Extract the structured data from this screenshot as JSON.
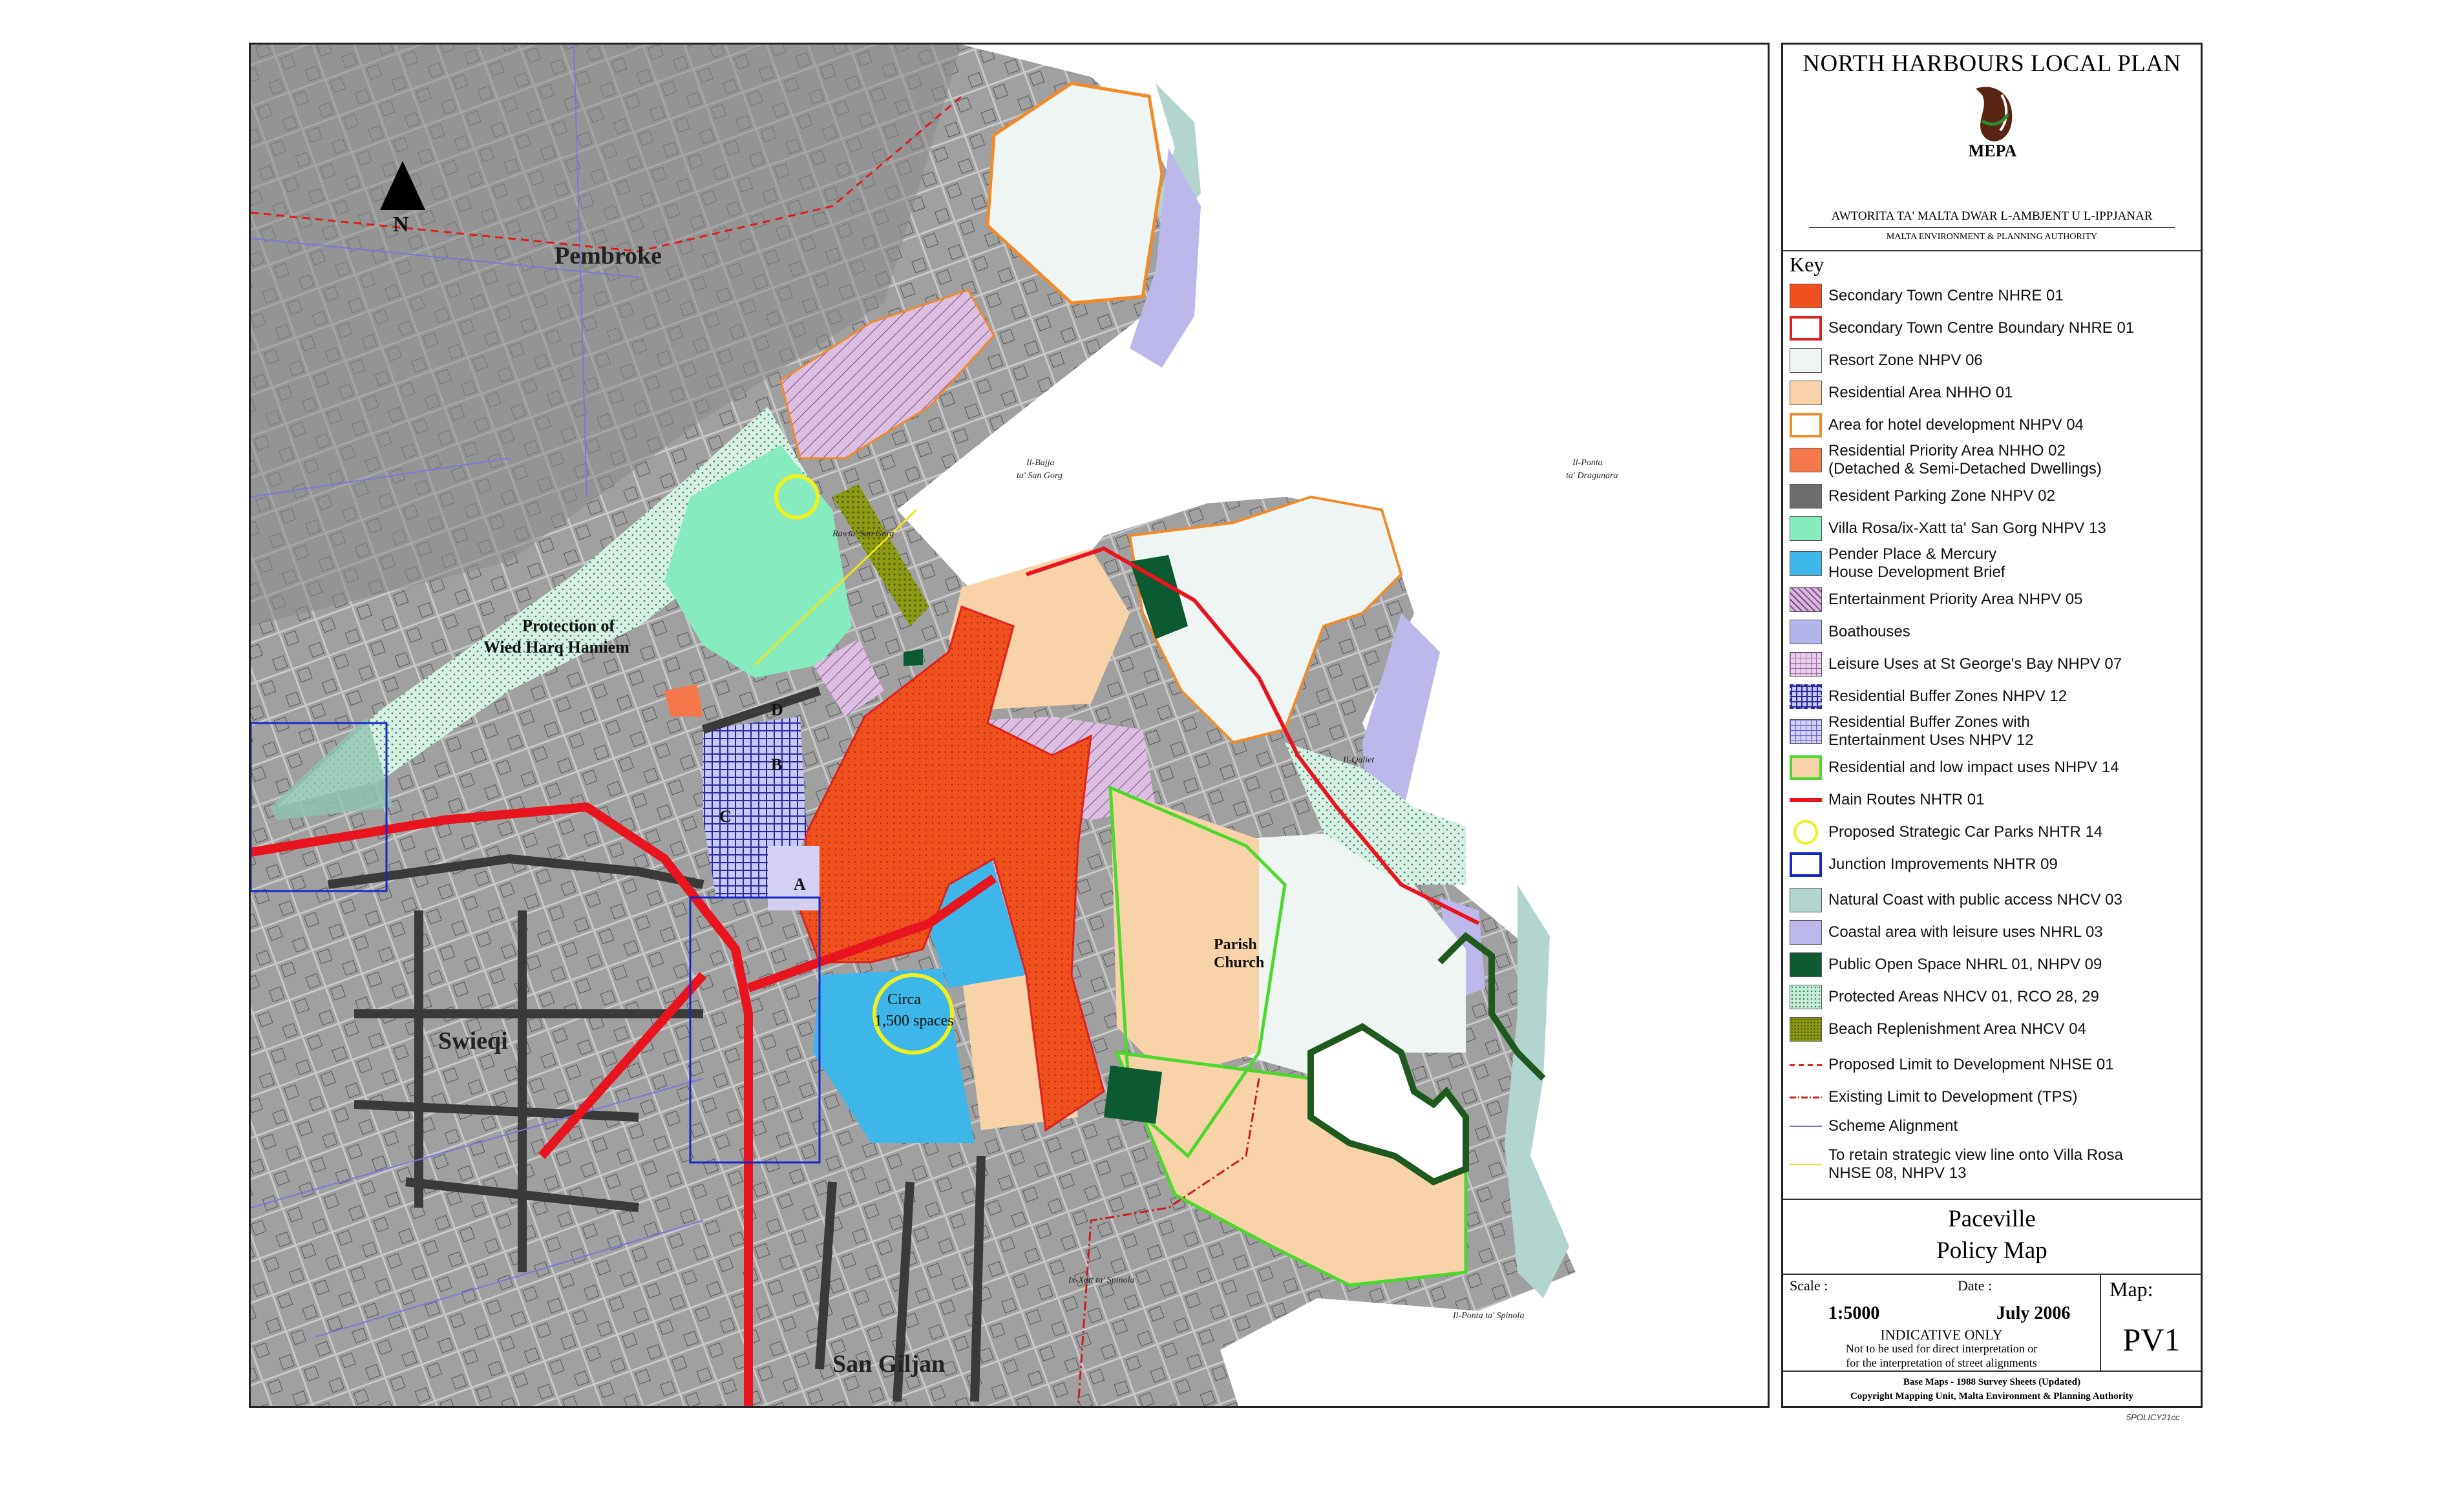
{
  "map": {
    "north_label": "N",
    "places": {
      "pembroke": "Pembroke",
      "swieqi": "Swieqi",
      "san_giljan": "San Giljan",
      "wied_line1": "Protection of",
      "wied_line2": "Wied Harq Hamiem",
      "parish_line1": "Parish",
      "parish_line2": "Church",
      "car_park_line1": "Circa",
      "car_park_line2": "1,500 spaces",
      "il_bajja": "Il-Bajja",
      "ta_san_gorg": "ta' San Gorg",
      "ras_san_gorg": "Ras ta' San Gorg",
      "il_ponta": "Il-Ponta",
      "ta_dragunara": "ta' Dragunara",
      "il_qaliet": "Il-Qaliet",
      "xatt_spinola": "Ix-Xatt ta' Spinola",
      "ponta_spinola": "Il-Ponta ta' Spinola"
    },
    "junction_letters": [
      "A",
      "B",
      "C",
      "D"
    ]
  },
  "panel": {
    "plan_title": "NORTH HARBOURS LOCAL PLAN",
    "logo_text": "MEPA",
    "authority_maltese": "AWTORITA  TA' MALTA DWAR L-AMBJENT U L-IPPJANAR",
    "authority_english": "MALTA ENVIRONMENT & PLANNING AUTHORITY",
    "key_heading": "Key",
    "legend": [
      {
        "label": "Secondary Town Centre NHRE 01",
        "style": "fill",
        "color": "#f0501e"
      },
      {
        "label": "Secondary Town Centre Boundary NHRE 01",
        "style": "outline",
        "color": "#e02020"
      },
      {
        "label": "Resort Zone NHPV 06",
        "style": "fill",
        "color": "#eef5f2"
      },
      {
        "label": "Residential Area NHHO 01",
        "style": "fill",
        "color": "#f8d3a8"
      },
      {
        "label": "Area for hotel development NHPV 04",
        "style": "outline",
        "color": "#f08a2a"
      },
      {
        "label": "Residential Priority Area NHHO 02\n(Detached & Semi-Detached Dwellings)",
        "style": "fill",
        "color": "#f5784a"
      },
      {
        "label": "Resident Parking Zone NHPV 02",
        "style": "fill",
        "color": "#6e6e6e"
      },
      {
        "label": "Villa Rosa/ix-Xatt ta' San Gorg NHPV 13",
        "style": "fill",
        "color": "#86ecc0"
      },
      {
        "label": "Pender Place & Mercury\nHouse Development Brief",
        "style": "fill",
        "color": "#3fb6ea"
      },
      {
        "label": "Entertainment Priority Area NHPV 05",
        "style": "hatch",
        "color": "#d8b8dc"
      },
      {
        "label": "Boathouses",
        "style": "fill",
        "color": "#b4b4ec"
      },
      {
        "label": "Leisure Uses at St George's Bay NHPV 07",
        "style": "grid",
        "color": "#e8d0e8"
      },
      {
        "label": "Residential Buffer Zones NHPV 12",
        "style": "bluegrid",
        "color": "#c8c8f4"
      },
      {
        "label": "Residential Buffer Zones with\nEntertainment Uses NHPV 12",
        "style": "bluegrid2",
        "color": "#d4d0f4"
      },
      {
        "label": "Residential and low impact uses NHPV 14",
        "style": "greenoutline",
        "color": "#4cd82c"
      },
      {
        "label": "Main Routes NHTR 01",
        "style": "line",
        "color": "#e8141e"
      },
      {
        "label": "Proposed Strategic Car Parks NHTR 14",
        "style": "circle",
        "color": "#f0f01e"
      },
      {
        "label": "Junction Improvements NHTR 09",
        "style": "outline",
        "color": "#1428c8"
      },
      {
        "label": "Natural Coast with public access NHCV 03",
        "style": "fill",
        "color": "#b4d4d0"
      },
      {
        "label": "Coastal area with leisure uses NHRL 03",
        "style": "fill",
        "color": "#bcb8ec"
      },
      {
        "label": "Public Open Space NHRL 01, NHPV 09",
        "style": "fill",
        "color": "#0c5a32"
      },
      {
        "label": "Protected Areas NHCV 01, RCO 28, 29",
        "style": "dots",
        "color": "#c8ecd8"
      },
      {
        "label": "Beach Replenishment Area NHCV 04",
        "style": "olive",
        "color": "#8c9a14"
      },
      {
        "label": "Proposed Limit to Development NHSE 01",
        "style": "dashed",
        "color": "#e01e1e"
      },
      {
        "label": "Existing Limit to Development (TPS)",
        "style": "dashdot",
        "color": "#c81e1e"
      },
      {
        "label": "Scheme Alignment",
        "style": "thinline",
        "color": "#7878dc"
      },
      {
        "label": "To retain strategic view line onto Villa Rosa\nNHSE 08, NHPV 13",
        "style": "thinline",
        "color": "#f0e614"
      }
    ],
    "map_name_line1": "Paceville",
    "map_name_line2": "Policy Map",
    "scale_caption": "Scale :",
    "scale_value": "1:5000",
    "date_caption": "Date :",
    "date_value": "July 2006",
    "indicative": "INDICATIVE ONLY",
    "not_direct": "Not to be used for direct interpretation or",
    "not_street": "for the interpretation of street alignments",
    "map_caption": "Map:",
    "map_id": "PV1",
    "base_maps": "Base Maps - 1988 Survey Sheets (Updated)",
    "copyright": "Copyright Mapping Unit, Malta Environment & Planning Authority"
  },
  "drawing_ref": "5POLICY21cc"
}
